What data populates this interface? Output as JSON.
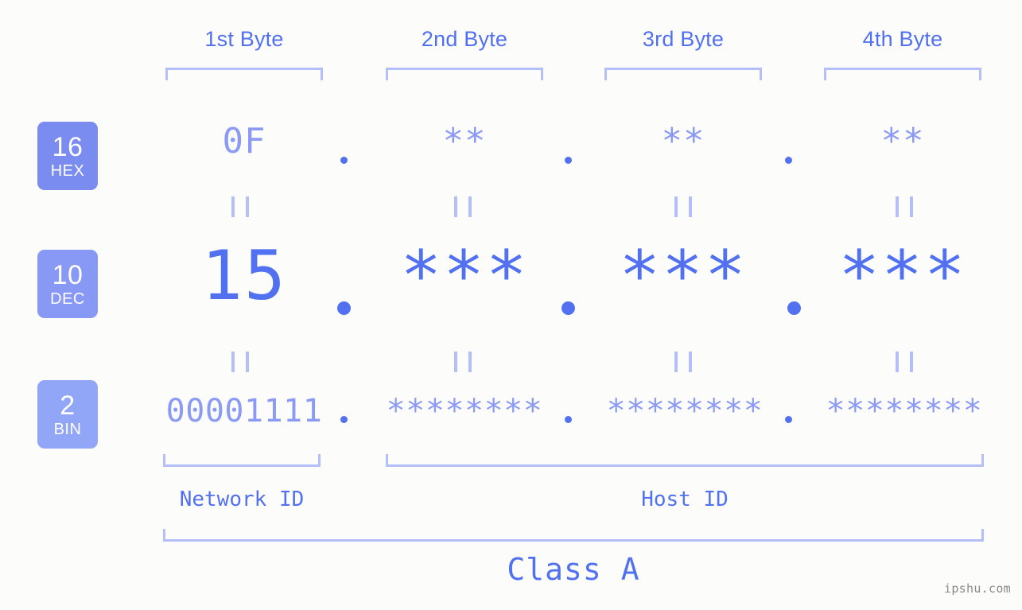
{
  "background_color": "#fcfdfa",
  "colors": {
    "accent_strong": "#5271f0",
    "accent_mid": "#8b9af5",
    "accent_light": "#b4bffa",
    "badge_hex": "#7a8cf0",
    "badge_dec": "#8899f5",
    "badge_bin": "#92a6f8",
    "watermark": "#8a8a8a"
  },
  "byte_headers": [
    {
      "label": "1st Byte"
    },
    {
      "label": "2nd Byte"
    },
    {
      "label": "3rd Byte"
    },
    {
      "label": "4th Byte"
    }
  ],
  "bases": [
    {
      "num": "16",
      "name": "HEX"
    },
    {
      "num": "10",
      "name": "DEC"
    },
    {
      "num": "2",
      "name": "BIN"
    }
  ],
  "rows": {
    "hex": {
      "base_num": "16",
      "base_name": "HEX",
      "values": [
        "0F",
        "**",
        "**",
        "**"
      ],
      "separator": "."
    },
    "dec": {
      "base_num": "10",
      "base_name": "DEC",
      "values": [
        "15",
        "***",
        "***",
        "***"
      ],
      "separator": "."
    },
    "bin": {
      "base_num": "2",
      "base_name": "BIN",
      "values": [
        "00001111",
        "********",
        "********",
        "********"
      ],
      "separator": "."
    }
  },
  "equals_mark": "||",
  "sections": [
    {
      "label": "Network ID"
    },
    {
      "label": "Host ID"
    }
  ],
  "class_label": "Class A",
  "watermark": "ipshu.com"
}
